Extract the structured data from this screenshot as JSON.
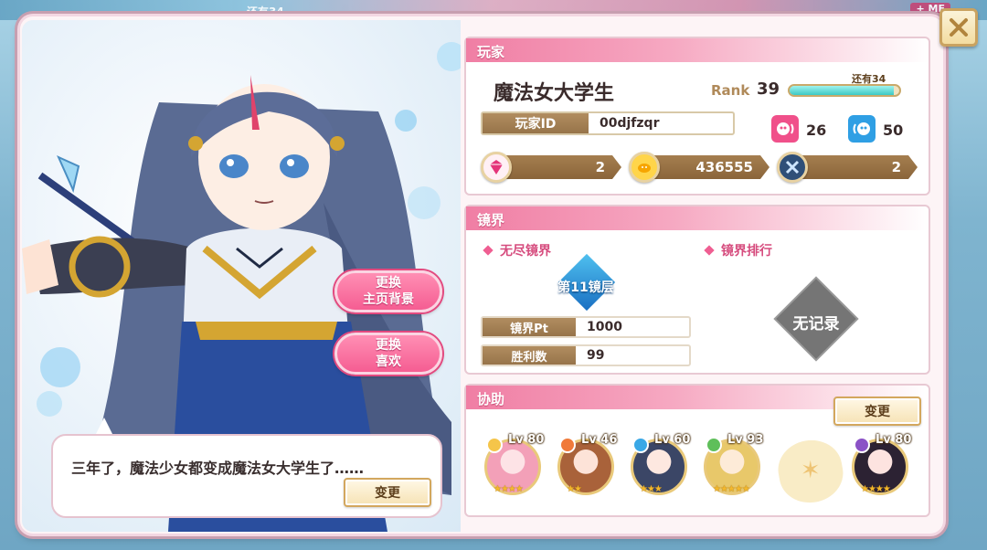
{
  "background": {
    "top_hint_text": "还有34",
    "top_right_tag": "+ ME"
  },
  "character": {
    "speech": "三年了，魔法少女都变成魔法女大学生了……"
  },
  "buttons": {
    "change_bg": [
      "更换",
      "主页背景"
    ],
    "change_fav": [
      "更换",
      "喜欢"
    ],
    "speech_change": "变更",
    "support_change": "变更"
  },
  "player": {
    "section_title": "玩家",
    "name": "魔法女大学生",
    "rank_label": "Rank",
    "rank": "39",
    "exp_remaining": "还有34",
    "exp_fraction": 0.95,
    "id_label": "玩家ID",
    "id": "00djfzqr",
    "pink_count": "26",
    "blue_count": "50",
    "resources": {
      "gems": "2",
      "coins": "436555",
      "items": "2"
    }
  },
  "mirror": {
    "section_title": "镜界",
    "endless_label": "无尽镜界",
    "ranking_label": "镜界排行",
    "floor": "第11镜层",
    "pt_label": "镜界Pt",
    "pt_value": "1000",
    "wins_label": "胜利数",
    "wins_value": "99",
    "no_record": "无记录"
  },
  "support": {
    "section_title": "协助",
    "members": [
      {
        "lv": "Lv 80",
        "element": "light",
        "element_color": "#f5c54a"
      },
      {
        "lv": "Lv 46",
        "element": "fire",
        "element_color": "#f07a3a"
      },
      {
        "lv": "Lv 60",
        "element": "water",
        "element_color": "#3aa8e6"
      },
      {
        "lv": "Lv 93",
        "element": "wood",
        "element_color": "#5fbf5a"
      },
      {
        "lv": "Lv 80",
        "element": "dark",
        "element_color": "#8b52c6"
      }
    ]
  },
  "colors": {
    "accent_pink": "#f07ea4",
    "brown": "#97744a",
    "gold_border": "#d3a75d"
  }
}
